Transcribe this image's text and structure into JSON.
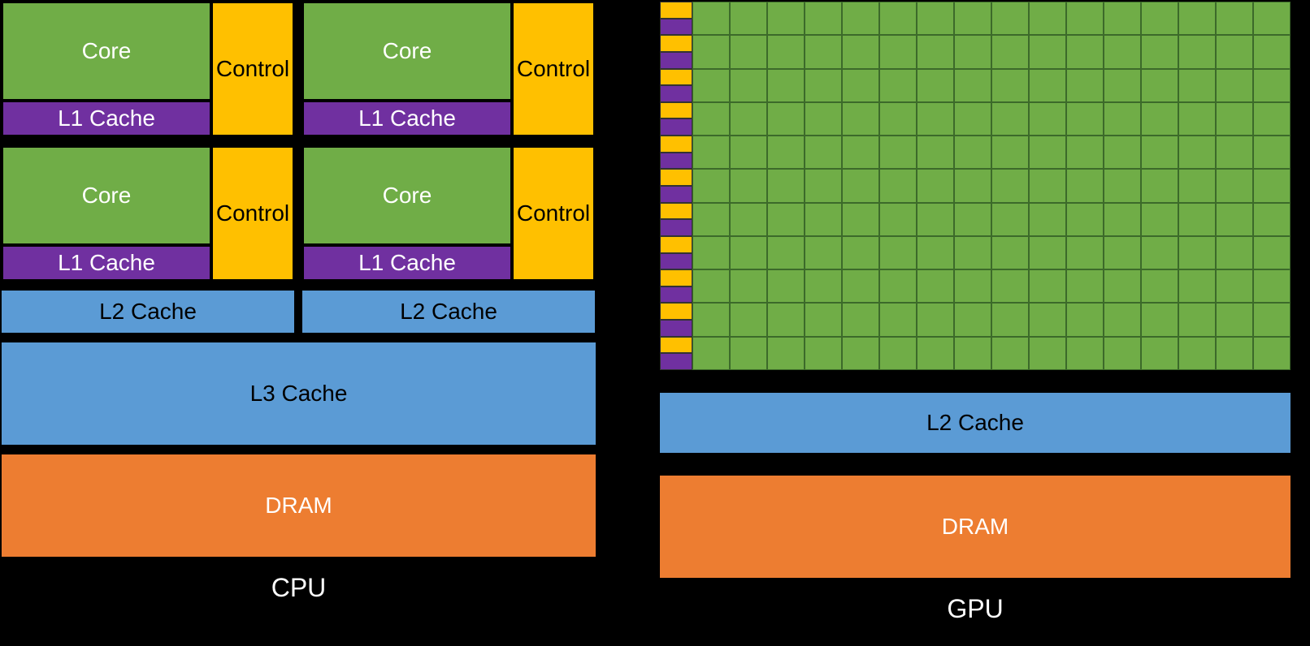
{
  "colors": {
    "core": "#70AD47",
    "control": "#FFC000",
    "l1": "#7030A0",
    "l2_l3": "#5B9BD5",
    "dram": "#ED7D31"
  },
  "cpu": {
    "title": "CPU",
    "core_label": "Core",
    "control_label": "Control",
    "l1_label": "L1 Cache",
    "l2_label": "L2 Cache",
    "l3_label": "L3 Cache",
    "dram_label": "DRAM",
    "num_cores": 4,
    "l2_count": 2
  },
  "gpu": {
    "title": "GPU",
    "l2_label": "L2 Cache",
    "dram_label": "DRAM",
    "sm_stripe_rows": 22,
    "grid_cols": 16,
    "grid_rows": 11
  }
}
